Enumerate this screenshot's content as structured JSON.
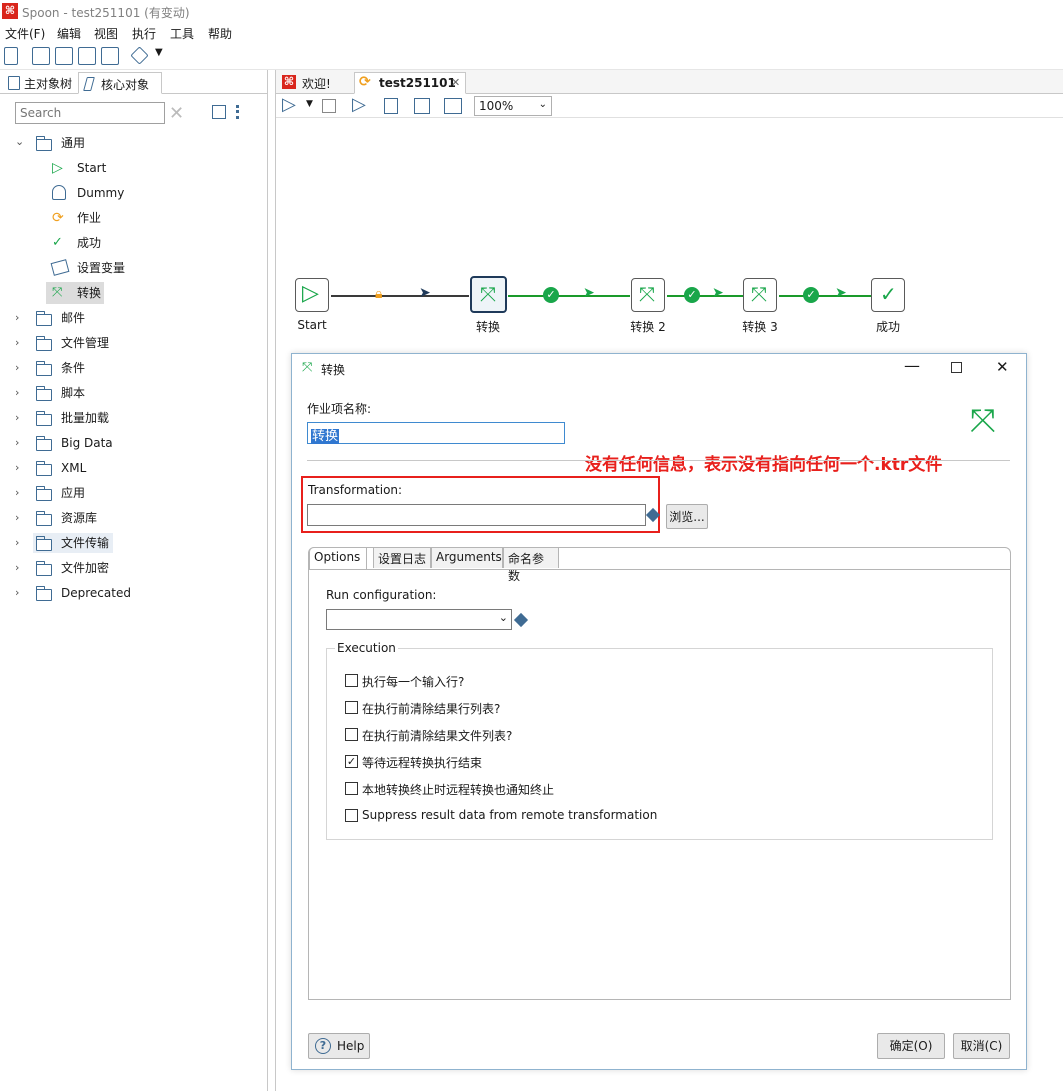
{
  "window": {
    "title": "Spoon - test251101 (有变动)"
  },
  "menu": [
    "文件(F)",
    "编辑",
    "视图",
    "执行",
    "工具",
    "帮助"
  ],
  "left_tabs": [
    "主对象树",
    "核心对象"
  ],
  "search": {
    "placeholder": "Search"
  },
  "tree": {
    "general": "通用",
    "general_items": [
      "Start",
      "Dummy",
      "作业",
      "成功",
      "设置变量",
      "转换"
    ],
    "folders": [
      "邮件",
      "文件管理",
      "条件",
      "脚本",
      "批量加载",
      "Big Data",
      "XML",
      "应用",
      "资源库",
      "文件传输",
      "文件加密",
      "Deprecated"
    ]
  },
  "right_tabs": [
    "欢迎!",
    "test251101"
  ],
  "zoom": "100%",
  "flow": {
    "nodes": [
      "Start",
      "转换",
      "转换 2",
      "转换 3",
      "成功"
    ]
  },
  "dialog": {
    "title": "转换",
    "name_label": "作业项名称:",
    "name_value": "转换",
    "annotation": "没有任何信息，表示没有指向任何一个.ktr文件",
    "trans_label": "Transformation:",
    "trans_value": "",
    "browse": "浏览...",
    "tabs": [
      "Options",
      "设置日志",
      "Arguments",
      "命名参数"
    ],
    "run_config_label": "Run configuration:",
    "execution_label": "Execution",
    "checkboxes": [
      {
        "label": "执行每一个输入行?",
        "checked": false
      },
      {
        "label": "在执行前清除结果行列表?",
        "checked": false
      },
      {
        "label": "在执行前清除结果文件列表?",
        "checked": false
      },
      {
        "label": "等待远程转换执行结束",
        "checked": true
      },
      {
        "label": "本地转换终止时远程转换也通知终止",
        "checked": false
      },
      {
        "label": "Suppress result data from remote transformation",
        "checked": false
      }
    ],
    "help": "Help",
    "ok": "确定(O)",
    "cancel": "取消(C)"
  },
  "colors": {
    "annotation": "#e8201c",
    "hop_ok": "#19a64a",
    "accent": "#3f6b93"
  }
}
